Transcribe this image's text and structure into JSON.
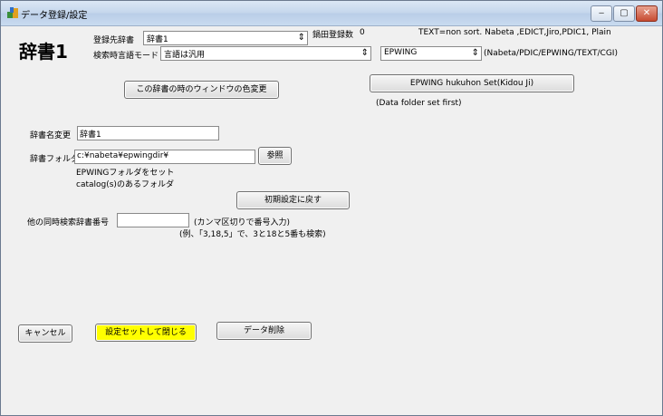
{
  "window": {
    "title": "データ登録/設定",
    "controls": {
      "minimize": "‒",
      "maximize": "▢",
      "close": "✕"
    }
  },
  "header": {
    "dict_name_large": "辞書1",
    "target_label": "登録先辞書",
    "target_value": "辞書1",
    "count_label": "鍋田登録数",
    "count_value": "0",
    "mode_label": "検索時言語モード",
    "mode_value": "言語は汎用",
    "text_hint": "TEXT=non sort. Nabeta ,EDICT,Jiro,PDIC1, Plain",
    "type_value": "EPWING",
    "type_hint": "(Nabeta/PDIC/EPWING/TEXT/CGI)"
  },
  "buttons": {
    "color_change": "この辞書の時のウィンドウの色変更",
    "epwing_set": "EPWING hukuhon Set(Kidou Ji)",
    "browse": "参照",
    "reset": "初期設定に戻す",
    "cancel": "キャンセル",
    "save_close": "設定セットして閉じる",
    "delete": "データ削除"
  },
  "notes": {
    "data_folder": "(Data folder set first)",
    "epwing_folder1": "EPWINGフォルダをセット",
    "epwing_folder2": "catalog(s)のあるフォルダ",
    "comma_hint": "(カンマ区切りで番号入力)",
    "example_hint": "(例、「3,18,5」で、3と18と5番も検索)"
  },
  "fields": {
    "rename_label": "辞書名変更",
    "rename_value": "辞書1",
    "folder_label": "辞書フォルダ",
    "folder_value": "c:¥nabeta¥epwingdir¥",
    "simul_label": "他の同時検索辞書番号",
    "simul_value": ""
  },
  "colors": {
    "save_button": "#ffff00"
  }
}
